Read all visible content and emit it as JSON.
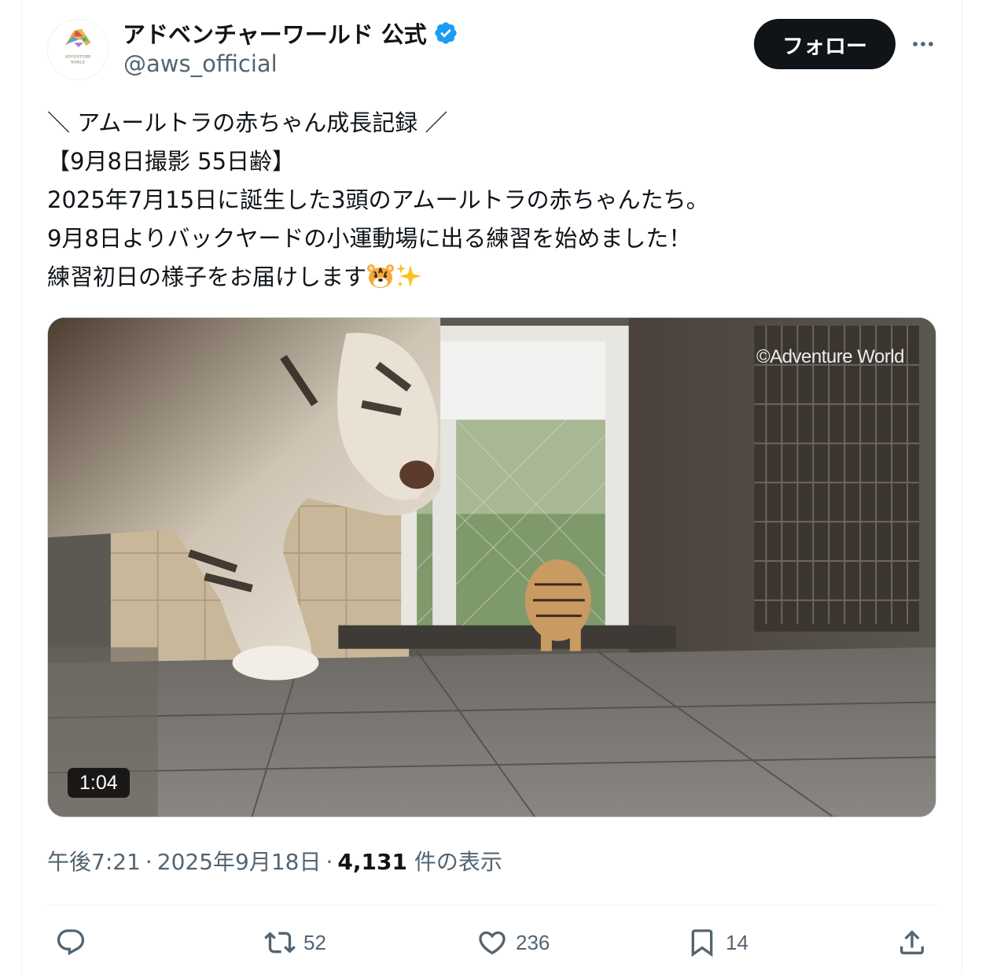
{
  "account": {
    "display_name": "アドベンチャーワールド 公式",
    "handle": "@aws_official",
    "verified": true,
    "avatar_logo_text": [
      "ADVENTURE",
      "WORLD"
    ]
  },
  "header": {
    "follow_label": "フォロー",
    "more_icon": "more-horizontal-icon"
  },
  "tweet": {
    "lines": [
      "＼ アムールトラの赤ちゃん成長記録 ／",
      "【9月8日撮影 55日齢】",
      "2025年7月15日に誕生した3頭のアムールトラの赤ちゃんたち。",
      "9月8日よりバックヤードの小運動場に出る練習を始めました！",
      "練習初日の様子をお届けします"
    ],
    "trailing_emojis": [
      "tiger-face-emoji",
      "sparkles-emoji"
    ]
  },
  "media": {
    "type": "video",
    "watermark": "©Adventure World",
    "duration": "1:04"
  },
  "meta": {
    "time": "午後7:21",
    "date": "2025年9月18日",
    "views_count": "4,131",
    "views_label": "件の表示",
    "separator": "·"
  },
  "actions": {
    "reply": {
      "icon": "reply-icon",
      "count": ""
    },
    "retweet": {
      "icon": "retweet-icon",
      "count": "52"
    },
    "like": {
      "icon": "heart-icon",
      "count": "236"
    },
    "bookmark": {
      "icon": "bookmark-icon",
      "count": "14"
    },
    "share": {
      "icon": "share-icon",
      "count": ""
    }
  },
  "colors": {
    "text_primary": "#0f1419",
    "text_secondary": "#536471",
    "verified_blue": "#1d9bf0",
    "follow_bg": "#0f1419"
  }
}
